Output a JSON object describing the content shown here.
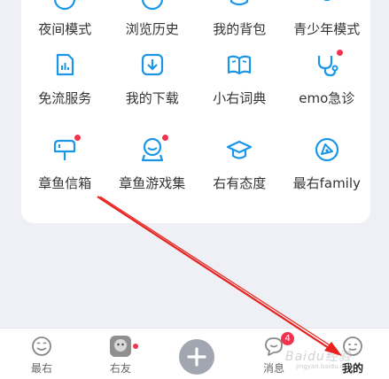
{
  "colors": {
    "icon_blue": "#1a96e8",
    "dot_red": "#f2334f",
    "arrow_red": "#e8231f"
  },
  "grid": {
    "items": [
      {
        "label": "夜间模式",
        "icon": "moon-icon"
      },
      {
        "label": "浏览历史",
        "icon": "clock-icon"
      },
      {
        "label": "我的背包",
        "icon": "backpack-icon"
      },
      {
        "label": "青少年模式",
        "icon": "shield-icon"
      },
      {
        "label": "免流服务",
        "icon": "data-chart-icon"
      },
      {
        "label": "我的下载",
        "icon": "download-icon"
      },
      {
        "label": "小右词典",
        "icon": "book-icon"
      },
      {
        "label": "emo急诊",
        "icon": "stethoscope-icon"
      },
      {
        "label": "章鱼信箱",
        "icon": "mailbox-icon"
      },
      {
        "label": "章鱼游戏集",
        "icon": "game-icon"
      },
      {
        "label": "右有态度",
        "icon": "graduation-cap-icon"
      },
      {
        "label": "最右family",
        "icon": "family-icon"
      }
    ]
  },
  "tabbar": {
    "tabs": [
      {
        "label": "最右",
        "icon": "smiley-icon"
      },
      {
        "label": "右友",
        "icon": "avatar-icon"
      },
      {
        "label": "消息",
        "icon": "chat-icon",
        "badge": "4"
      },
      {
        "label": "我的",
        "icon": "profile-icon"
      }
    ],
    "plus": "+"
  },
  "watermark": {
    "main": "Baidu经验",
    "sub": "jingyan.baidu.com"
  }
}
